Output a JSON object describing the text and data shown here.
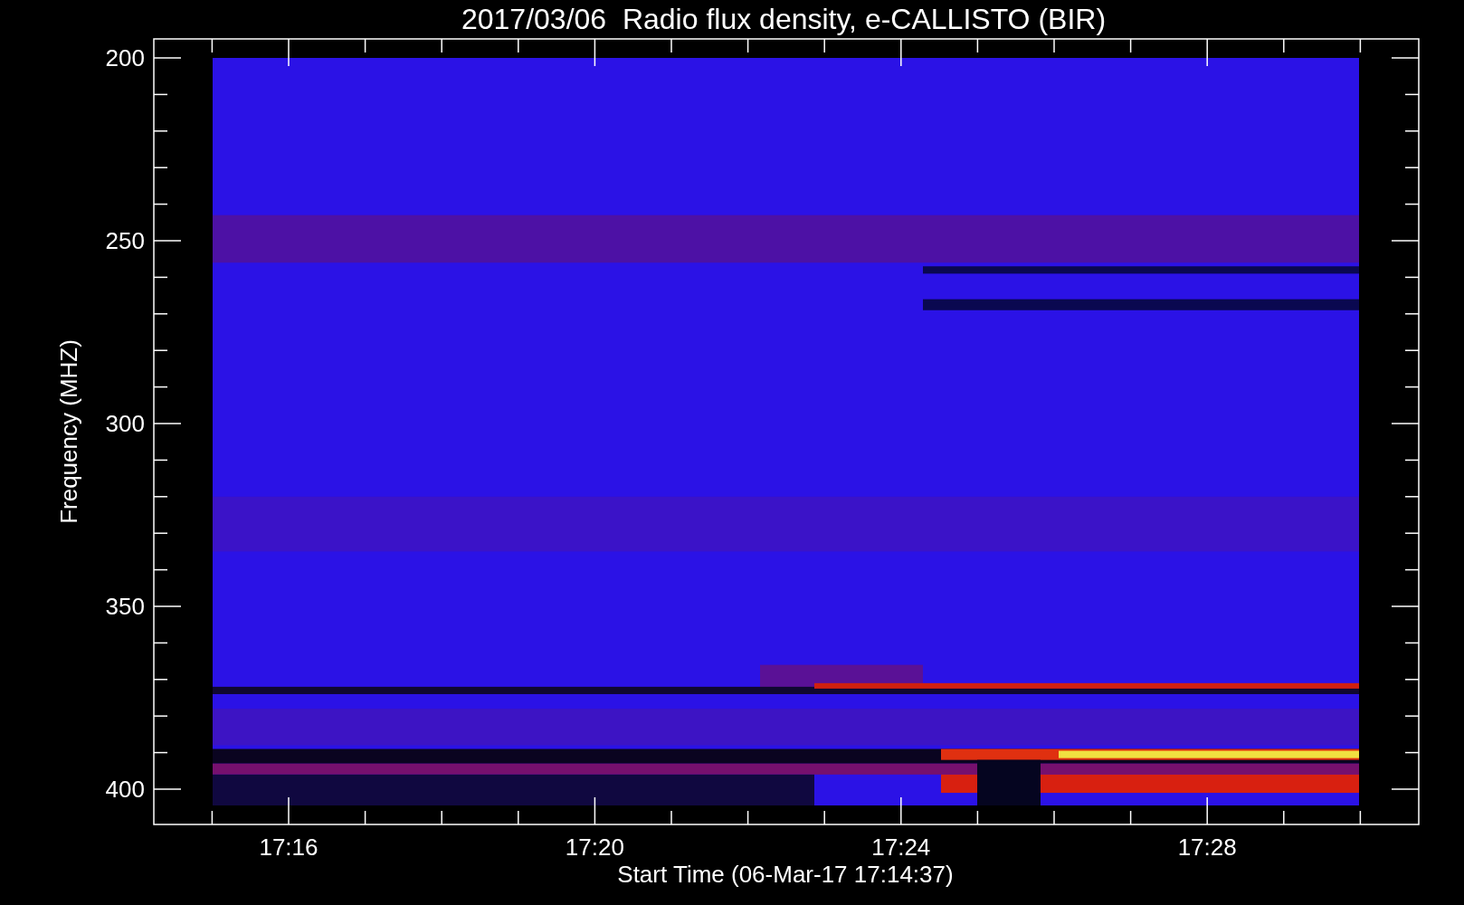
{
  "title": "2017/03/06  Radio flux density, e-CALLISTO (BIR)",
  "y_axis": {
    "label": "Frequency (MHZ)",
    "tick_labels": [
      "200",
      "250",
      "300",
      "350",
      "400"
    ]
  },
  "x_axis": {
    "label": "Start Time (06-Mar-17 17:14:37)",
    "tick_labels": [
      "17:16",
      "17:20",
      "17:24",
      "17:28"
    ]
  }
}
